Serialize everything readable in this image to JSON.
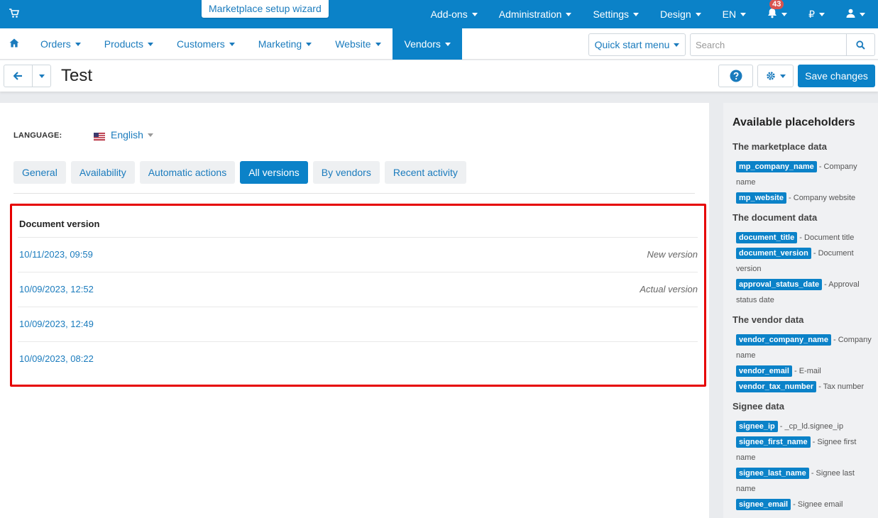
{
  "topbar": {
    "wizard_label": "Marketplace setup wizard",
    "items": [
      {
        "label": "Add-ons"
      },
      {
        "label": "Administration"
      },
      {
        "label": "Settings"
      },
      {
        "label": "Design"
      },
      {
        "label": "EN"
      }
    ],
    "notifications_count": "43",
    "currency_symbol": "₽"
  },
  "nav": {
    "items": [
      {
        "label": "Orders"
      },
      {
        "label": "Products"
      },
      {
        "label": "Customers"
      },
      {
        "label": "Marketing"
      },
      {
        "label": "Website"
      },
      {
        "label": "Vendors"
      }
    ],
    "active": "Vendors",
    "quick_start_label": "Quick start menu",
    "search_placeholder": "Search"
  },
  "header": {
    "title": "Test",
    "save_label": "Save changes"
  },
  "content": {
    "language_label": "LANGUAGE:",
    "language_value": "English",
    "tabs": [
      {
        "label": "General"
      },
      {
        "label": "Availability"
      },
      {
        "label": "Automatic actions"
      },
      {
        "label": "All versions"
      },
      {
        "label": "By vendors"
      },
      {
        "label": "Recent activity"
      }
    ],
    "active_tab": "All versions",
    "versions_header": "Document version",
    "versions": [
      {
        "date": "10/11/2023, 09:59",
        "status": "New version"
      },
      {
        "date": "10/09/2023, 12:52",
        "status": "Actual version"
      },
      {
        "date": "10/09/2023, 12:49",
        "status": ""
      },
      {
        "date": "10/09/2023, 08:22",
        "status": ""
      }
    ]
  },
  "sidebar": {
    "title": "Available placeholders",
    "groups": [
      {
        "title": "The marketplace data"
      },
      {
        "title": "The document data"
      },
      {
        "title": "The vendor data"
      },
      {
        "title": "Signee data"
      }
    ],
    "placeholders": [
      {
        "tag": "mp_company_name",
        "desc": " - Company name"
      },
      {
        "tag": "mp_website",
        "desc": " - Company website"
      },
      {
        "tag": "document_title",
        "desc": " - Document title"
      },
      {
        "tag": "document_version",
        "desc": " - Document version"
      },
      {
        "tag": "approval_status_date",
        "desc": " - Approval status date"
      },
      {
        "tag": "vendor_company_name",
        "desc": " - Company name"
      },
      {
        "tag": "vendor_email",
        "desc": " - E-mail"
      },
      {
        "tag": "vendor_tax_number",
        "desc": " - Tax number"
      },
      {
        "tag": "signee_ip",
        "desc": " - _cp_ld.signee_ip"
      },
      {
        "tag": "signee_first_name",
        "desc": " - Signee first name"
      },
      {
        "tag": "signee_last_name",
        "desc": " - Signee last name"
      },
      {
        "tag": "signee_email",
        "desc": " - Signee email"
      }
    ]
  },
  "colors": {
    "primary": "#0b82c8",
    "link": "#1a7bbd",
    "highlight_border": "#e60000",
    "badge": "#d9534f"
  }
}
